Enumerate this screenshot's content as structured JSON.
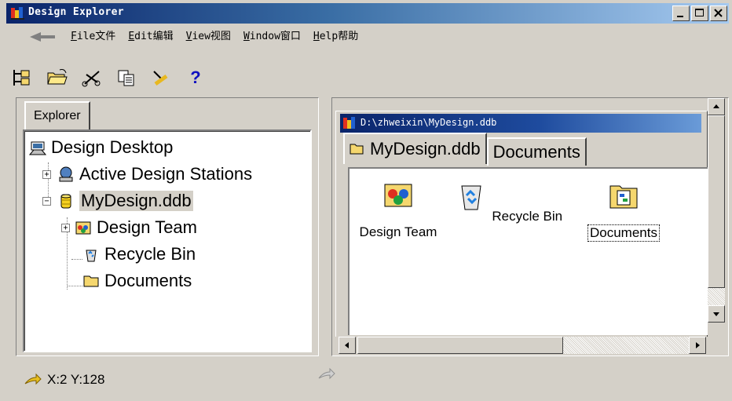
{
  "window": {
    "title": "Design Explorer"
  },
  "menu": {
    "items": [
      {
        "key": "F",
        "rest": "ile文件"
      },
      {
        "key": "E",
        "rest": "dit编辑"
      },
      {
        "key": "V",
        "rest": "iew视图"
      },
      {
        "key": "W",
        "rest": "indow窗口"
      },
      {
        "key": "H",
        "rest": "elp帮助"
      }
    ]
  },
  "toolbar": {
    "help_glyph": "?"
  },
  "explorer": {
    "tab_label": "Explorer",
    "tree": {
      "root": "Design Desktop",
      "active_stations": "Active Design Stations",
      "db": "MyDesign.ddb",
      "design_team": "Design Team",
      "recycle_bin": "Recycle Bin",
      "documents": "Documents"
    }
  },
  "document_window": {
    "title": "D:\\zhweixin\\MyDesign.ddb",
    "tabs": [
      "MyDesign.ddb",
      "Documents"
    ],
    "items": [
      "Design Team",
      "Recycle Bin",
      "Documents"
    ]
  },
  "status": {
    "coords": "X:2 Y:128"
  },
  "colors": {
    "face": "#d4d0c8",
    "title_dark": "#0a246a",
    "title_light": "#a6caf0",
    "folder": "#f5d76e"
  }
}
